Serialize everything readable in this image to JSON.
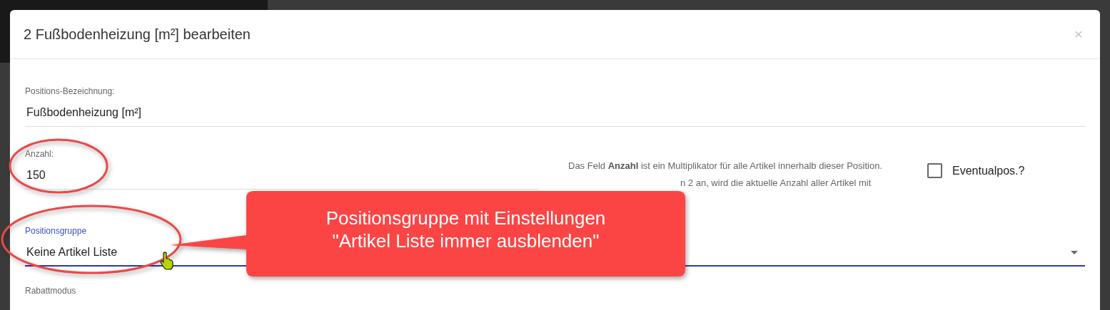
{
  "dialog": {
    "title": "2 Fußbodenheizung [m²] bearbeiten",
    "close": "×",
    "name_field": {
      "label": "Positions-Bezeichnung:",
      "value": "Fußbodenheizung [m²]",
      "focused": false
    },
    "quantity_field": {
      "label": "Anzahl:",
      "value": "150",
      "focused": false
    },
    "help_text": [
      "Das Feld **Anzahl** ist ein Multiplikator für alle Artikel innerhalb dieser Position.",
      "n 2 an, wird die aktuelle Anzahl aller Artikel mit"
    ],
    "checkbox": {
      "label": "Eventualpos.?",
      "checked": false
    },
    "group_field": {
      "label": "Positionsgruppe",
      "value": "Keine Artikel Liste",
      "focused": true
    },
    "discount_field": {
      "label": "Rabattmodus",
      "focused": false
    }
  },
  "annotation": {
    "callout": "Positionsgruppe mit Einstellungen\n\"Artikel Liste immer ausblenden\""
  }
}
